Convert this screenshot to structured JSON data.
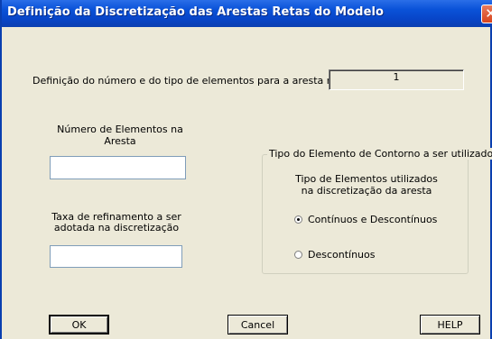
{
  "window": {
    "title": "Definição da Discretização das Arestas Retas do Modelo",
    "close_glyph": "✕"
  },
  "edge": {
    "prompt": "Definição do número e do tipo de elementos para a aresta reta de número",
    "number": "1"
  },
  "elements": {
    "label": "Número de Elementos na Aresta",
    "value": ""
  },
  "refinement": {
    "label": "Taxa de refinamento a ser adotada na discretização",
    "value": ""
  },
  "contour_group": {
    "title": "Tipo do Elemento de Contorno a ser utilizado",
    "subtitle": "Tipo de Elementos utilizados na discretização da aresta",
    "options": [
      {
        "label": "Contínuos e Descontínuos",
        "selected": true
      },
      {
        "label": "Descontínuos",
        "selected": false
      }
    ]
  },
  "buttons": {
    "ok": "OK",
    "cancel": "Cancel",
    "help": "HELP"
  }
}
